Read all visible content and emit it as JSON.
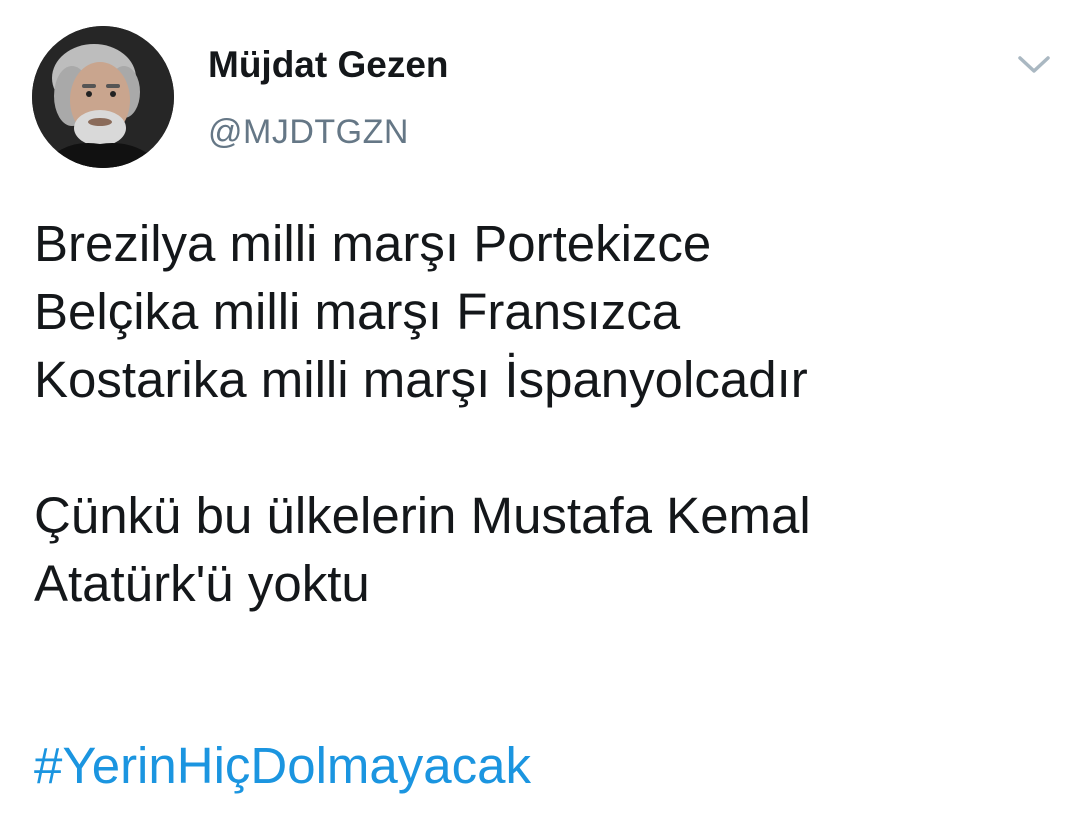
{
  "author": {
    "display_name": "Müjdat Gezen",
    "handle": "@MJDTGZN",
    "avatar_icon": "profile-photo"
  },
  "menu": {
    "icon": "chevron-down-icon"
  },
  "tweet": {
    "lines": [
      "Brezilya milli marşı Portekizce",
      "Belçika milli marşı Fransızca",
      "Kostarika milli marşı İspanyolcadır",
      "",
      "Çünkü bu ülkelerin Mustafa Kemal",
      "Atatürk'ü yoktu"
    ],
    "hashtag": "#YerinHiçDolmayacak"
  },
  "colors": {
    "text": "#14171a",
    "handle": "#657786",
    "hashtag": "#1b95e0",
    "caret": "#aab8c2"
  }
}
